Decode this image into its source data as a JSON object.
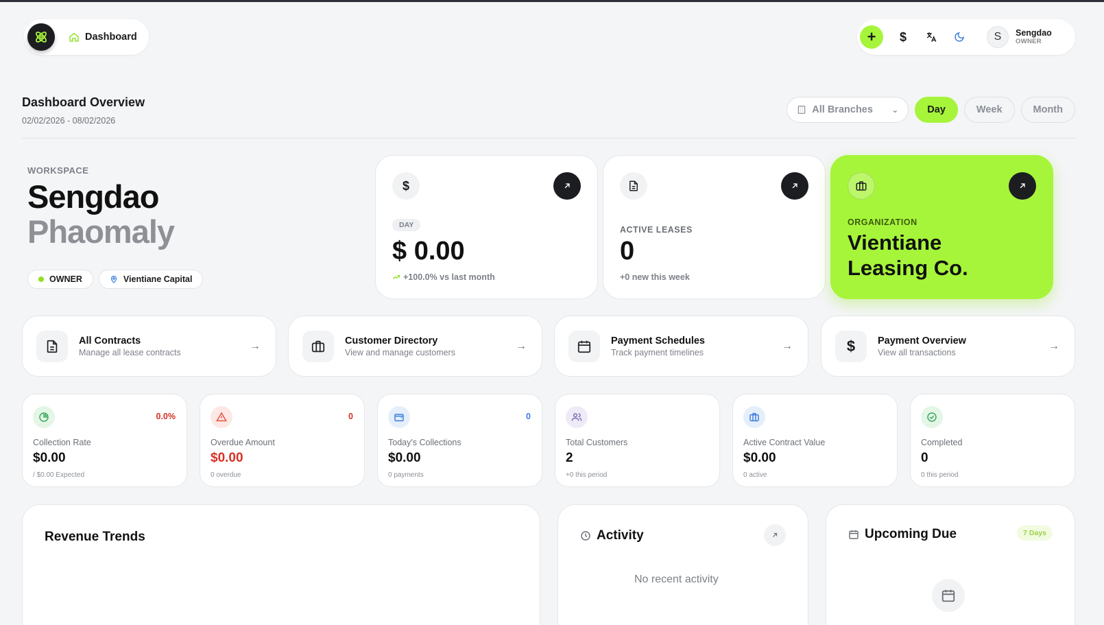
{
  "header": {
    "nav_label": "Dashboard",
    "icons": [
      "brand-logo-icon",
      "home-icon",
      "plus-icon",
      "dollar-icon",
      "translate-icon",
      "moon-icon"
    ],
    "currency_symbol": "$",
    "add_symbol": "+",
    "user": {
      "initial": "S",
      "name": "Sengdao",
      "role": "OWNER"
    }
  },
  "overview": {
    "title": "Dashboard Overview",
    "date_range": "02/02/2026 - 08/02/2026",
    "branch_select": "All Branches",
    "periods": [
      "Day",
      "Week",
      "Month"
    ],
    "active_period": "Day"
  },
  "workspace": {
    "label": "WORKSPACE",
    "first_name": "Sengdao",
    "last_name": "Phaomaly",
    "role_badge": "OWNER",
    "location_badge": "Vientiane Capital"
  },
  "stat_cards": {
    "revenue": {
      "icon_symbol": "$",
      "chip": "DAY",
      "value": "$ 0.00",
      "trend": "+100.0% vs last month"
    },
    "leases": {
      "label": "ACTIVE LEASES",
      "value": "0",
      "foot": "+0 new this week"
    },
    "organization": {
      "label": "ORGANIZATION",
      "name": "Vientiane Leasing Co."
    }
  },
  "nav_cards": [
    {
      "title": "All Contracts",
      "subtitle": "Manage all lease contracts",
      "icon": "document-icon"
    },
    {
      "title": "Customer Directory",
      "subtitle": "View and manage customers",
      "icon": "briefcase-icon"
    },
    {
      "title": "Payment Schedules",
      "subtitle": "Track payment timelines",
      "icon": "calendar-icon"
    },
    {
      "title": "Payment Overview",
      "subtitle": "View all transactions",
      "icon": "dollar-icon",
      "symbol": "$"
    }
  ],
  "metrics": [
    {
      "label": "Collection Rate",
      "value": "$0.00",
      "sub": "/ $0.00 Expected",
      "badge": "0.0%",
      "badge_color": "#d93025",
      "icon": "pie-icon",
      "icon_bg": "#e4f6e6",
      "icon_color": "#3aa55c"
    },
    {
      "label": "Overdue Amount",
      "value": "$0.00",
      "sub": "0 overdue",
      "badge": "0",
      "badge_color": "#d93025",
      "icon": "alert-icon",
      "icon_bg": "#fde8e6",
      "icon_color": "#e0543e",
      "value_color": "#d93025"
    },
    {
      "label": "Today's Collections",
      "value": "$0.00",
      "sub": "0 payments",
      "badge": "0",
      "badge_color": "#3b7ddd",
      "icon": "wallet-icon",
      "icon_bg": "#e5effc",
      "icon_color": "#3b7ddd"
    },
    {
      "label": "Total Customers",
      "value": "2",
      "sub": "+0 this period",
      "badge": "",
      "icon": "users-icon",
      "icon_bg": "#eeeaf7",
      "icon_color": "#7a6bb5"
    },
    {
      "label": "Active Contract Value",
      "value": "$0.00",
      "sub": "0 active",
      "badge": "",
      "icon": "briefcase-icon",
      "icon_bg": "#e5effc",
      "icon_color": "#3b7ddd"
    },
    {
      "label": "Completed",
      "value": "0",
      "sub": "0 this period",
      "badge": "",
      "icon": "check-circle-icon",
      "icon_bg": "#e4f6e6",
      "icon_color": "#3aa55c"
    }
  ],
  "panels": {
    "revenue": {
      "title": "Revenue Trends"
    },
    "activity": {
      "title": "Activity",
      "empty": "No recent activity"
    },
    "upcoming": {
      "title": "Upcoming Due",
      "chip": "7 Days"
    }
  },
  "colors": {
    "accent": "#a6f53a",
    "dark": "#1c1d21",
    "background": "#f4f5f7"
  }
}
